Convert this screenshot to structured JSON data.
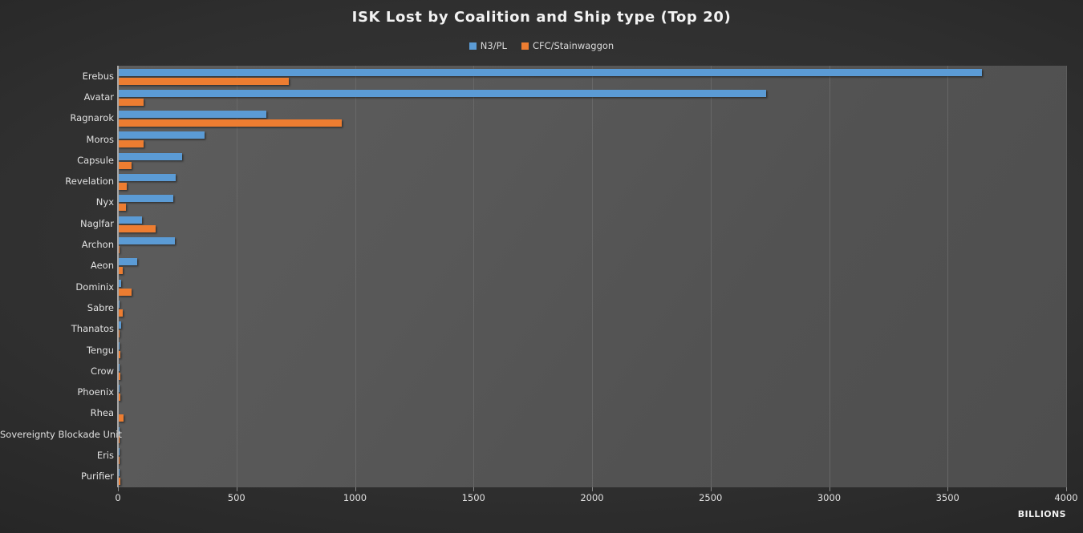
{
  "chart_data": {
    "type": "bar",
    "orientation": "horizontal",
    "title": "ISK Lost by Coalition and Ship type (Top 20)",
    "xlabel": "BILLIONS",
    "ylabel": "",
    "xlim": [
      0,
      4000
    ],
    "xticks": [
      0,
      500,
      1000,
      1500,
      2000,
      2500,
      3000,
      3500,
      4000
    ],
    "grid": true,
    "legend_position": "top-center",
    "categories": [
      "Erebus",
      "Avatar",
      "Ragnarok",
      "Moros",
      "Capsule",
      "Revelation",
      "Nyx",
      "Naglfar",
      "Archon",
      "Aeon",
      "Dominix",
      "Sabre",
      "Thanatos",
      "Tengu",
      "Crow",
      "Phoenix",
      "Rhea",
      "Sovereignty Blockade Unit",
      "Eris",
      "Purifier"
    ],
    "series": [
      {
        "name": "N3/PL",
        "color": "#5B9BD5",
        "values": [
          3645,
          2735,
          627,
          367,
          272,
          245,
          232,
          103,
          240,
          82,
          13,
          4,
          15,
          6,
          7,
          6,
          0,
          3,
          7,
          8
        ]
      },
      {
        "name": "CFC/Stainwaggon",
        "color": "#ED7D31",
        "values": [
          720,
          108,
          945,
          107,
          57,
          38,
          34,
          160,
          2,
          20,
          56,
          20,
          8,
          10,
          10,
          9,
          22,
          4,
          5,
          9
        ]
      }
    ]
  },
  "colors": {
    "series_n3pl": "#5B9BD5",
    "series_cfc": "#ED7D31",
    "plot_background": "#565656",
    "page_background": "#2A2A2A",
    "gridline": "#6D6D6D",
    "text": "#E8E8E8"
  }
}
